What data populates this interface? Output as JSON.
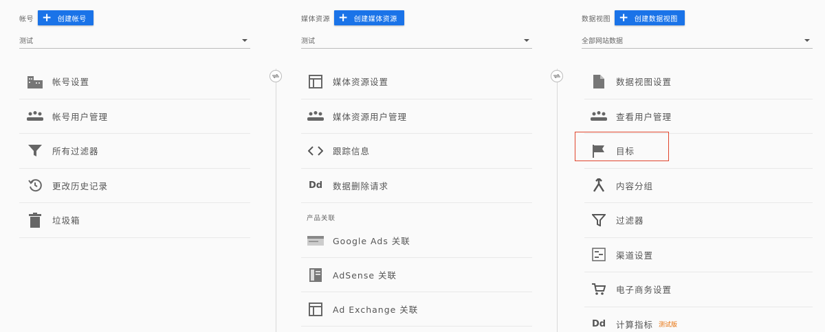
{
  "account": {
    "header_label": "帐号",
    "create_button": "创建帐号",
    "selector_value": "测试",
    "items": [
      {
        "label": "帐号设置",
        "icon": "building-icon"
      },
      {
        "label": "帐号用户管理",
        "icon": "users-icon"
      },
      {
        "label": "所有过滤器",
        "icon": "filter-icon"
      },
      {
        "label": "更改历史记录",
        "icon": "history-icon"
      },
      {
        "label": "垃圾箱",
        "icon": "trash-icon"
      }
    ]
  },
  "property": {
    "header_label": "媒体资源",
    "create_button": "创建媒体资源",
    "selector_value": "测试",
    "items": [
      {
        "label": "媒体资源设置",
        "icon": "layout-icon"
      },
      {
        "label": "媒体资源用户管理",
        "icon": "users-icon"
      },
      {
        "label": "跟踪信息",
        "icon": "code-icon"
      },
      {
        "label": "数据删除请求",
        "icon": "dd-icon"
      }
    ],
    "section_label": "产品关联",
    "linked_items": [
      {
        "label": "Google Ads 关联",
        "icon": "ads-icon"
      },
      {
        "label": "AdSense 关联",
        "icon": "adsense-icon"
      },
      {
        "label": "Ad Exchange 关联",
        "icon": "layout-icon"
      }
    ]
  },
  "view": {
    "header_label": "数据视图",
    "create_button": "创建数据视图",
    "selector_value": "全部网站数据",
    "items": [
      {
        "label": "数据视图设置",
        "icon": "document-icon"
      },
      {
        "label": "查看用户管理",
        "icon": "users-icon"
      },
      {
        "label": "目标",
        "icon": "flag-icon"
      },
      {
        "label": "内容分组",
        "icon": "grouping-icon"
      },
      {
        "label": "过滤器",
        "icon": "filter-icon"
      },
      {
        "label": "渠道设置",
        "icon": "channel-icon"
      },
      {
        "label": "电子商务设置",
        "icon": "cart-icon"
      },
      {
        "label": "计算指标",
        "icon": "dd-icon",
        "badge": "测试版"
      }
    ]
  },
  "colors": {
    "accent": "#1a73e8",
    "highlight": "#e0442b",
    "badge": "#e8710a"
  }
}
